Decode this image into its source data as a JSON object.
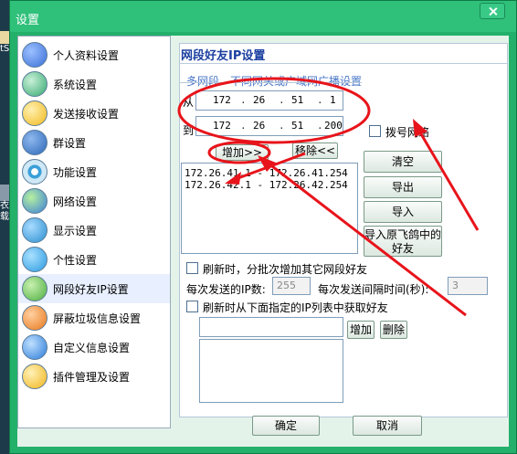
{
  "window": {
    "title": "设置"
  },
  "desktop": {
    "labels": [
      "tS",
      "衣载"
    ]
  },
  "sidebar": {
    "items": [
      {
        "label": "个人资料设置",
        "icon": "globe-icon",
        "color": "#3a6fd8"
      },
      {
        "label": "系统设置",
        "icon": "snowflake-icon",
        "color": "#35a870"
      },
      {
        "label": "发送接收设置",
        "icon": "bulb-icon",
        "color": "#f1b91e"
      },
      {
        "label": "群设置",
        "icon": "earth-icon",
        "color": "#2b67b8"
      },
      {
        "label": "功能设置",
        "icon": "target-icon",
        "color": "#3aa0d8"
      },
      {
        "label": "网络设置",
        "icon": "network-icon",
        "color": "#3a7fd8"
      },
      {
        "label": "显示设置",
        "icon": "monitor-icon",
        "color": "#2a8fd0"
      },
      {
        "label": "个性设置",
        "icon": "star-icon",
        "color": "#2a9ae0"
      },
      {
        "label": "网段好友IP设置",
        "icon": "chain-icon",
        "color": "#4cae3d"
      },
      {
        "label": "屏蔽垃圾信息设置",
        "icon": "shield-icon",
        "color": "#e8771b"
      },
      {
        "label": "自定义信息设置",
        "icon": "tools-icon",
        "color": "#2a7ad8"
      },
      {
        "label": "插件管理及设置",
        "icon": "lightbulb-icon",
        "color": "#f0b419"
      }
    ]
  },
  "panel": {
    "title": "网段好友IP设置",
    "tabs": [
      "多网段",
      "不同网关或广域网广播设置"
    ],
    "from_label": "从",
    "to_label": "到",
    "from_ip": [
      "172",
      "26",
      "51",
      "1"
    ],
    "to_ip": [
      "172",
      "26",
      "51",
      "200"
    ],
    "dialup_label": "拨号网络",
    "add_label": "增加>>",
    "remove_label": "移除<<",
    "ip_ranges": [
      "172.26.41.1 - 172.26.41.254",
      "172.26.42.1 - 172.26.42.254"
    ],
    "clear_label": "清空",
    "export_label": "导出",
    "import_label": "导入",
    "import_feige_label": "导入原飞鸽中的好友",
    "refresh_batch_label": "刷新时，分批次增加其它网段好友",
    "per_send_ip_label": "每次发送的IP数:",
    "per_send_ip_value": "255",
    "interval_label": "每次发送间隔时间(秒):",
    "interval_value": "3",
    "refresh_list_label": "刷新时从下面指定的IP列表中获取好友",
    "add_ip_label": "增加",
    "delete_ip_label": "删除",
    "ip_input_value": ""
  },
  "footer": {
    "ok_label": "确定",
    "cancel_label": "取消"
  },
  "colors": {
    "annotation": "#e8141b",
    "title_bar": "#2fc07a",
    "panel_title": "#1b3fa0"
  }
}
